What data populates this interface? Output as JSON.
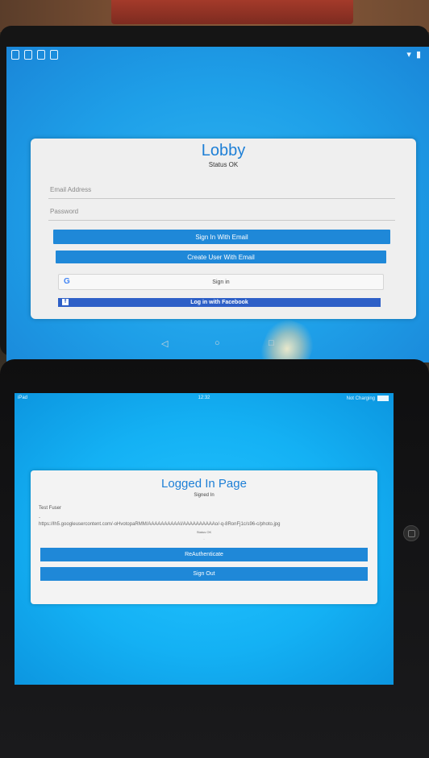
{
  "android": {
    "status_icons": [
      "notification-icon",
      "image-icon",
      "calendar-icon",
      "lock-icon"
    ],
    "status_right": [
      "wifi-icon",
      "battery-icon"
    ],
    "lobby": {
      "title": "Lobby",
      "status": "Status OK",
      "email_placeholder": "Email Address",
      "password_placeholder": "Password",
      "sign_in_email": "Sign In With Email",
      "create_user_email": "Create User With Email",
      "google_sign_in": "Sign in",
      "google_icon_glyph": "G",
      "facebook_login": "Log in with Facebook",
      "facebook_icon_glyph": "f"
    },
    "nav": {
      "back": "◁",
      "home": "○",
      "recents": "□"
    }
  },
  "ipad": {
    "status": {
      "device": "iPad",
      "time": "12:32",
      "charging": "Not Charging"
    },
    "logged_in": {
      "title": "Logged In Page",
      "subtitle": "Signed In",
      "user_name": "Test Fuser",
      "dash": "-",
      "photo_url": "https://lh5.googleusercontent.com/-oHvotopaRMM/AAAAAAAAAAI/AAAAAAAAAAo/-q-8RonFj1c/s96-c/photo.jpg",
      "status": "Status OK",
      "status_dash": "-",
      "reauth": "ReAuthenticate",
      "sign_out": "Sign Out"
    }
  },
  "colors": {
    "accent": "#1f88d8",
    "title_blue": "#1d7fd6",
    "facebook": "#2d5fc7",
    "screen_blue": "#1e9fe8"
  }
}
